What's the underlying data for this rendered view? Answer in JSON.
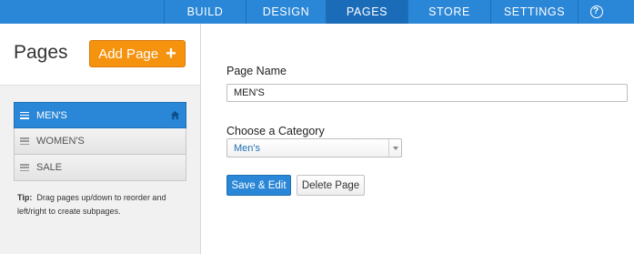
{
  "topnav": {
    "items": [
      {
        "label": "BUILD",
        "active": false
      },
      {
        "label": "DESIGN",
        "active": false
      },
      {
        "label": "PAGES",
        "active": true
      },
      {
        "label": "STORE",
        "active": false
      },
      {
        "label": "SETTINGS",
        "active": false
      }
    ],
    "help_label": "?"
  },
  "sidebar": {
    "title": "Pages",
    "add_button_label": "Add Page",
    "add_button_icon": "+",
    "pages": [
      {
        "label": "MEN'S",
        "active": true,
        "home": true
      },
      {
        "label": "WOMEN'S",
        "active": false,
        "home": false
      },
      {
        "label": "SALE",
        "active": false,
        "home": false
      }
    ],
    "tip_label": "Tip:",
    "tip_text": "Drag pages up/down to reorder and left/right to create subpages."
  },
  "form": {
    "page_name_label": "Page Name",
    "page_name_value": "MEN'S",
    "category_label": "Choose a Category",
    "category_value": "Men's",
    "save_button_label": "Save & Edit",
    "delete_button_label": "Delete Page"
  },
  "colors": {
    "accent_blue": "#2a86d6",
    "orange": "#f5930f"
  }
}
